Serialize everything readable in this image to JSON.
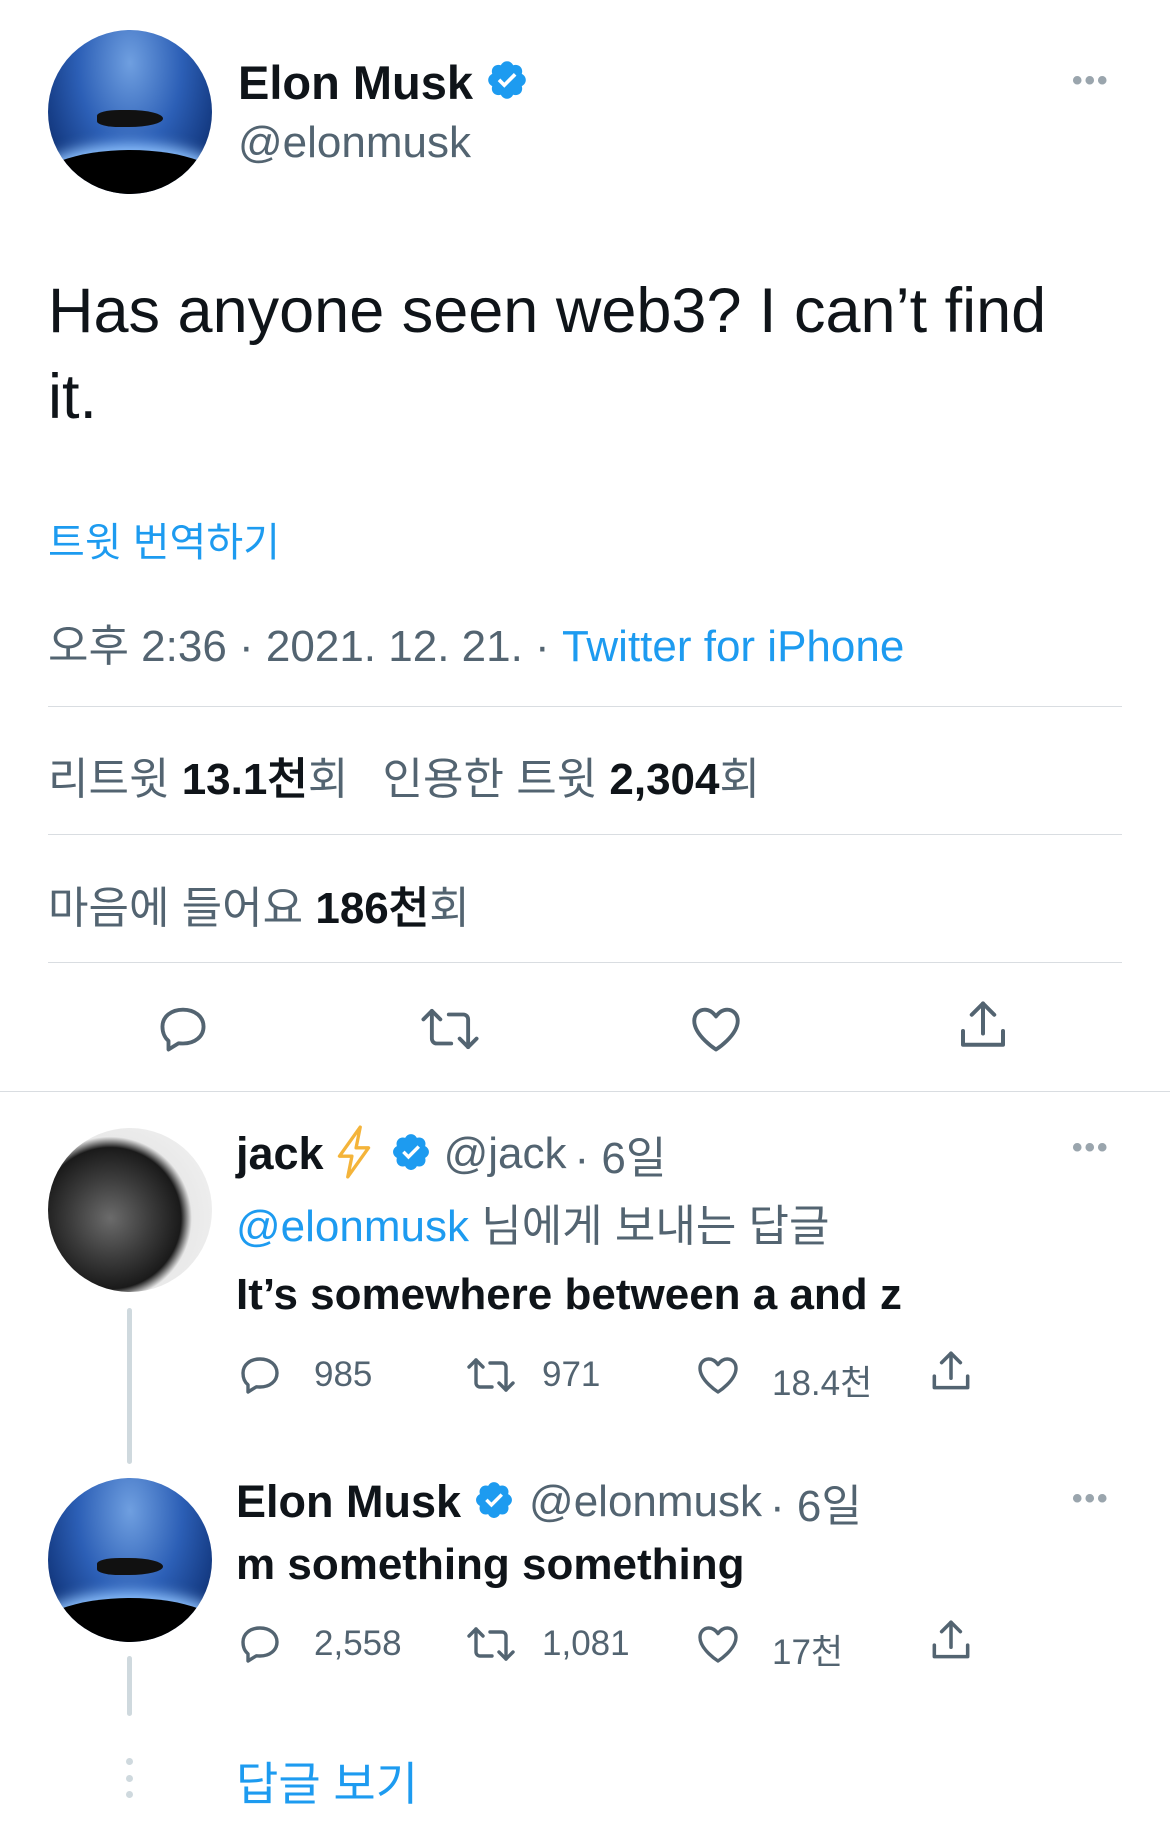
{
  "main_tweet": {
    "author_name": "Elon Musk",
    "author_handle": "@elonmusk",
    "text_line1": "Has anyone seen web3? I can’t find",
    "text_line2": "it.",
    "translate_link": "트윗 번역하기",
    "timestamp": "오후 2:36 · 2021. 12. 21. ·",
    "source": "Twitter for iPhone",
    "stats": {
      "retweets_label": "리트윗",
      "retweets_value": "13.1천",
      "retweets_suffix": "회",
      "quotes_label": "인용한 트윗",
      "quotes_value": "2,304",
      "quotes_suffix": "회",
      "likes_label": "마음에 들어요",
      "likes_value": "186천",
      "likes_suffix": "회"
    },
    "more_icon": "more-dots-icon"
  },
  "replies": [
    {
      "author_name": "jack",
      "emoji": "⚡",
      "author_handle": "@jack",
      "time": "· 6일",
      "reply_to_handle": "@elonmusk",
      "reply_to_suffix": " 님에게 보내는 답글",
      "text": "It’s somewhere between a and z",
      "counts": {
        "replies": "985",
        "retweets": "971",
        "likes": "18.4천"
      }
    },
    {
      "author_name": "Elon Musk",
      "author_handle": "@elonmusk",
      "time": "· 6일",
      "text": "m something something",
      "counts": {
        "replies": "2,558",
        "retweets": "1,081",
        "likes": "17천"
      }
    }
  ],
  "show_replies": "답글 보기",
  "colors": {
    "accent": "#1d9bf0",
    "text": "#0f1419",
    "muted": "#536471",
    "divider": "#d9dde1",
    "bolt": "#f4b43a"
  }
}
